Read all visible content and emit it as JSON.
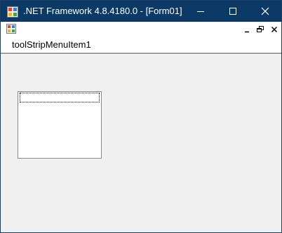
{
  "window": {
    "title": ".NET Framework 4.8.4180.0 - [Form01]",
    "icon": "dotnet-app-icon",
    "caption_buttons": [
      "minimize-icon",
      "maximize-icon",
      "close-icon"
    ]
  },
  "mdi_strip": {
    "child_icon": "form-icon",
    "buttons": [
      "mdi-minimize-icon",
      "mdi-restore-icon",
      "mdi-close-icon"
    ]
  },
  "menu": {
    "items": [
      {
        "label": "toolStripMenuItem1"
      }
    ]
  },
  "client": {
    "listbox": {
      "items": [],
      "focused_index": 0
    }
  },
  "colors": {
    "titlebar": "#0b3a66",
    "client": "#f0f0f0",
    "menubar": "#ffffff"
  }
}
